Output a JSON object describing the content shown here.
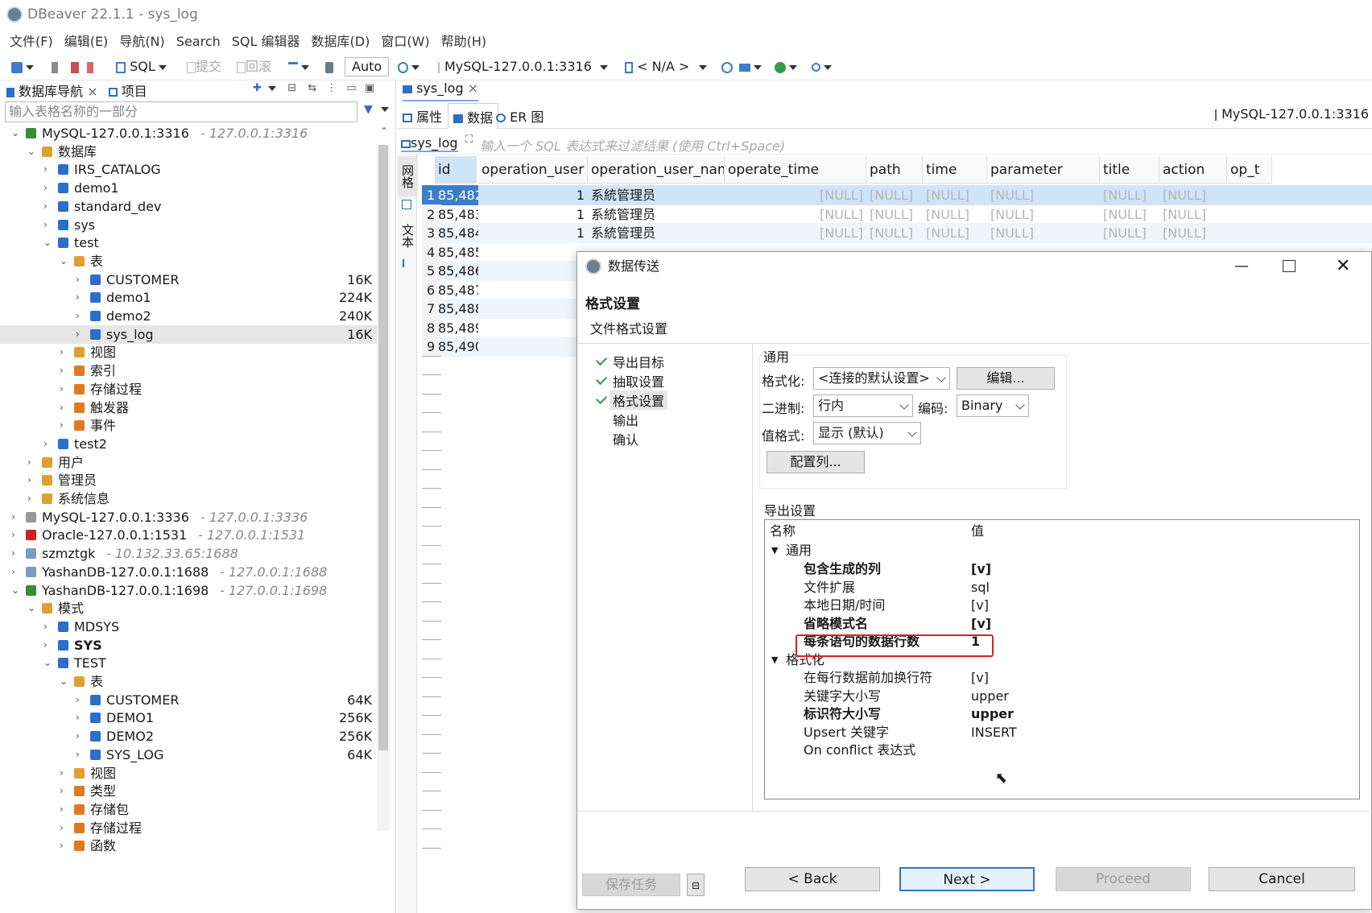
{
  "app": {
    "title": "DBeaver 22.1.1 - sys_log"
  },
  "menu": [
    "文件(F)",
    "编辑(E)",
    "导航(N)",
    "Search",
    "SQL 编辑器",
    "数据库(D)",
    "窗口(W)",
    "帮助(H)"
  ],
  "toolbar": {
    "sql": "SQL",
    "commit": "提交",
    "rollback": "回滚",
    "auto": "Auto",
    "connection": "MySQL-127.0.0.1:3316",
    "schema": "< N/A >"
  },
  "nav": {
    "tab_db": "数据库导航",
    "tab_project": "项目",
    "search_placeholder": "输入表格名称的一部分"
  },
  "tree": [
    {
      "d": 0,
      "e": "v",
      "label": "MySQL-127.0.0.1:3316",
      "host": "- 127.0.0.1:3316",
      "c": "#3a8a3a"
    },
    {
      "d": 1,
      "e": "v",
      "label": "数据库",
      "c": "#e0a030"
    },
    {
      "d": 2,
      "e": ">",
      "label": "IRS_CATALOG",
      "c": "#2a6fc9"
    },
    {
      "d": 2,
      "e": ">",
      "label": "demo1",
      "c": "#2a6fc9"
    },
    {
      "d": 2,
      "e": ">",
      "label": "standard_dev",
      "c": "#2a6fc9"
    },
    {
      "d": 2,
      "e": ">",
      "label": "sys",
      "c": "#2a6fc9"
    },
    {
      "d": 2,
      "e": "v",
      "label": "test",
      "c": "#2a6fc9"
    },
    {
      "d": 3,
      "e": "v",
      "label": "表",
      "c": "#e0a030"
    },
    {
      "d": 4,
      "e": ">",
      "label": "CUSTOMER",
      "size": "16K",
      "c": "#2a6fc9"
    },
    {
      "d": 4,
      "e": ">",
      "label": "demo1",
      "size": "224K",
      "c": "#2a6fc9"
    },
    {
      "d": 4,
      "e": ">",
      "label": "demo2",
      "size": "240K",
      "c": "#2a6fc9"
    },
    {
      "d": 4,
      "e": ">",
      "label": "sys_log",
      "size": "16K",
      "c": "#2a6fc9",
      "sel": true
    },
    {
      "d": 3,
      "e": ">",
      "label": "视图",
      "c": "#e0a030"
    },
    {
      "d": 3,
      "e": ">",
      "label": "索引",
      "c": "#e07a20"
    },
    {
      "d": 3,
      "e": ">",
      "label": "存储过程",
      "c": "#e07a20"
    },
    {
      "d": 3,
      "e": ">",
      "label": "触发器",
      "c": "#e07a20"
    },
    {
      "d": 3,
      "e": ">",
      "label": "事件",
      "c": "#e07a20"
    },
    {
      "d": 2,
      "e": ">",
      "label": "test2",
      "c": "#2a6fc9"
    },
    {
      "d": 1,
      "e": ">",
      "label": "用户",
      "c": "#e0a030"
    },
    {
      "d": 1,
      "e": ">",
      "label": "管理员",
      "c": "#e0a030"
    },
    {
      "d": 1,
      "e": ">",
      "label": "系统信息",
      "c": "#e0a030"
    },
    {
      "d": 0,
      "e": ">",
      "label": "MySQL-127.0.0.1:3336",
      "host": "- 127.0.0.1:3336",
      "c": "#999"
    },
    {
      "d": 0,
      "e": ">",
      "label": "Oracle-127.0.0.1:1531",
      "host": "- 127.0.0.1:1531",
      "c": "#d02020"
    },
    {
      "d": 0,
      "e": ">",
      "label": "szmztgk",
      "host": "- 10.132.33.65:1688",
      "c": "#7a9cc0"
    },
    {
      "d": 0,
      "e": ">",
      "label": "YashanDB-127.0.0.1:1688",
      "host": "- 127.0.0.1:1688",
      "c": "#7a9cc0"
    },
    {
      "d": 0,
      "e": "v",
      "label": "YashanDB-127.0.0.1:1698",
      "host": "- 127.0.0.1:1698",
      "c": "#3a8a3a"
    },
    {
      "d": 1,
      "e": "v",
      "label": "模式",
      "c": "#e0a030"
    },
    {
      "d": 2,
      "e": ">",
      "label": "MDSYS",
      "c": "#2a6fc9"
    },
    {
      "d": 2,
      "e": ">",
      "label": "SYS",
      "c": "#2a6fc9",
      "bold": true
    },
    {
      "d": 2,
      "e": "v",
      "label": "TEST",
      "c": "#2a6fc9"
    },
    {
      "d": 3,
      "e": "v",
      "label": "表",
      "c": "#e0a030"
    },
    {
      "d": 4,
      "e": ">",
      "label": "CUSTOMER",
      "size": "64K",
      "c": "#2a6fc9"
    },
    {
      "d": 4,
      "e": ">",
      "label": "DEMO1",
      "size": "256K",
      "c": "#2a6fc9"
    },
    {
      "d": 4,
      "e": ">",
      "label": "DEMO2",
      "size": "256K",
      "c": "#2a6fc9"
    },
    {
      "d": 4,
      "e": ">",
      "label": "SYS_LOG",
      "size": "64K",
      "c": "#2a6fc9"
    },
    {
      "d": 3,
      "e": ">",
      "label": "视图",
      "c": "#e0a030"
    },
    {
      "d": 3,
      "e": ">",
      "label": "类型",
      "c": "#e07a20"
    },
    {
      "d": 3,
      "e": ">",
      "label": "存储包",
      "c": "#e07a20"
    },
    {
      "d": 3,
      "e": ">",
      "label": "存储过程",
      "c": "#e07a20"
    },
    {
      "d": 3,
      "e": ">",
      "label": "函数",
      "c": "#e07a20"
    }
  ],
  "editor": {
    "tab": "sys_log",
    "subtabs": [
      "属性",
      "数据",
      "ER 图"
    ],
    "conn_label": "MySQL-127.0.0.1:3316",
    "filter_table": "sys_log",
    "filter_placeholder": "输入一个 SQL 表达式来过滤结果 (使用 Ctrl+Space)",
    "vtab_grid": "网格",
    "vtab_text": "文本"
  },
  "grid": {
    "columns": [
      "id",
      "operation_user",
      "operation_user_name",
      "operate_time",
      "path",
      "time",
      "parameter",
      "title",
      "action",
      "op_t"
    ],
    "rows": [
      [
        "1",
        "85,482",
        "1",
        "系統管理员"
      ],
      [
        "2",
        "85,483",
        "1",
        "系統管理员"
      ],
      [
        "3",
        "85,484",
        "1",
        "系統管理员"
      ],
      [
        "4",
        "85,485"
      ],
      [
        "5",
        "85,486"
      ],
      [
        "6",
        "85,487"
      ],
      [
        "7",
        "85,488"
      ],
      [
        "8",
        "85,489"
      ],
      [
        "9",
        "85,490"
      ]
    ],
    "null": "[NULL]"
  },
  "dialog": {
    "title": "数据传送",
    "heading": "格式设置",
    "subheading": "文件格式设置",
    "steps": [
      "导出目标",
      "抽取设置",
      "格式设置",
      "输出",
      "确认"
    ],
    "general": "通用",
    "format_label": "格式化:",
    "format_value": "<连接的默认设置>",
    "edit_btn": "编辑...",
    "binary_label": "二进制:",
    "binary_value": "行内",
    "encoding_label": "编码:",
    "encoding_value": "Binary",
    "valfmt_label": "值格式:",
    "valfmt_value": "显示 (默认)",
    "config_btn": "配置列...",
    "export_settings": "导出设置",
    "col_name": "名称",
    "col_value": "值",
    "grp_general": "通用",
    "grp_format": "格式化",
    "props_general": [
      {
        "n": "包含生成的列",
        "v": "[v]",
        "b": true
      },
      {
        "n": "文件扩展",
        "v": "sql",
        "b": false
      },
      {
        "n": "本地日期/时间",
        "v": "[v]",
        "b": false
      },
      {
        "n": "省略模式名",
        "v": "[v]",
        "b": true
      },
      {
        "n": "每条语句的数据行数",
        "v": "1",
        "b": true
      }
    ],
    "props_format": [
      {
        "n": "在每行数据前加换行符",
        "v": "[v]",
        "b": false
      },
      {
        "n": "关键字大小写",
        "v": "upper",
        "b": false
      },
      {
        "n": "标识符大小写",
        "v": "upper",
        "b": true
      },
      {
        "n": "Upsert 关键字",
        "v": "INSERT",
        "b": false
      },
      {
        "n": "On conflict 表达式",
        "v": "",
        "b": false
      }
    ],
    "save_task": "保存任务",
    "back": "< Back",
    "next": "Next >",
    "proceed": "Proceed",
    "cancel": "Cancel",
    "highlight_color": "#e02020"
  }
}
